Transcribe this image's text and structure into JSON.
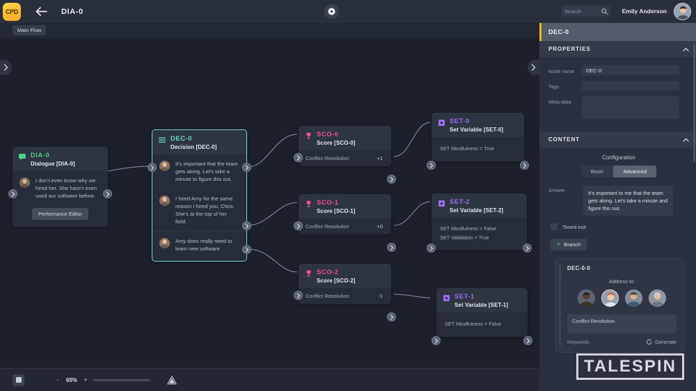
{
  "header": {
    "logo_text": "CPD",
    "back_icon": "back-arrow-icon",
    "title": "DIA-0",
    "play_icon": "play-icon",
    "search_placeholder": "Search",
    "search_value": "",
    "search_icon": "search-icon",
    "user_name": "Emily Anderson",
    "avatar": "user-avatar"
  },
  "canvas": {
    "flow_tab": "Main Flow",
    "nodes": [
      {
        "id": "DIA-0",
        "subtitle": "Dialogue [DIA-0]",
        "type": "dialogue",
        "accent": "#4fd08a",
        "lines": [
          "I don't even know why we hired her. She hasn't even used our software before."
        ],
        "button": "Performance Editor"
      },
      {
        "id": "DEC-0",
        "subtitle": "Decision [DEC-0]",
        "type": "decision",
        "accent": "#6fd9c9",
        "selected": true,
        "lines": [
          "It's important that the team gets along. Let's take a minute to figure this out.",
          "I hired Amy for the same reason I hired you, Chris. She's at the top of her field.",
          "Amy does really need to learn new software"
        ]
      },
      {
        "id": "SCO-0",
        "subtitle": "Score [SCO-0]",
        "type": "score",
        "accent": "#f0518f",
        "metric": "Conflict Resolution",
        "value": "+1"
      },
      {
        "id": "SCO-1",
        "subtitle": "Score [SCO-1]",
        "type": "score",
        "accent": "#f0518f",
        "metric": "Conflict Resolution",
        "value": "+0"
      },
      {
        "id": "SCO-2",
        "subtitle": "Score [SCO-2]",
        "type": "score",
        "accent": "#f0518f",
        "metric": "Conflict Resolution",
        "value": "-1"
      },
      {
        "id": "SET-0",
        "subtitle": "Set Variable [SET-0]",
        "type": "setvar",
        "accent": "#a06cf0",
        "assignments": [
          "SET Mindfulness = True"
        ]
      },
      {
        "id": "SET-2",
        "subtitle": "Set Variable [SET-2]",
        "type": "setvar",
        "accent": "#a06cf0",
        "assignments": [
          "SET Mindfulness = False",
          "SET Validation = True"
        ]
      },
      {
        "id": "SET-1",
        "subtitle": "Set Variable [SET-1]",
        "type": "setvar",
        "accent": "#a06cf0",
        "assignments": [
          "SET Mindfulness = False"
        ]
      }
    ]
  },
  "bottom_bar": {
    "fit_icon": "fit-to-screen-icon",
    "zoom_out": "-",
    "zoom_level": "65%",
    "zoom_in": "+",
    "warning_icon": "warning-icon"
  },
  "panel": {
    "title": "DEC-0",
    "accent_color": "#f5b81e",
    "properties": {
      "section_label": "PROPERTIES",
      "collapse_icon": "chevron-up-icon",
      "fields": [
        {
          "label": "Node name",
          "value": "DEC-0"
        },
        {
          "label": "Tags",
          "value": ""
        },
        {
          "label": "Meta-data",
          "value": ""
        }
      ]
    },
    "content": {
      "section_label": "CONTENT",
      "collapse_icon": "chevron-up-icon",
      "configuration_label": "Configuration",
      "tabs": [
        {
          "label": "Basic",
          "active": false
        },
        {
          "label": "Advanced",
          "active": true
        }
      ],
      "answer_label": "Answer",
      "answer_value": "It's important to me that the team gets along. Let's take a minute and figure this out.",
      "timed_exit_label": "Timed exit",
      "timed_exit_checked": false,
      "branch_button": "Branch",
      "branch_card": {
        "id": "DEC-0-0",
        "address_label": "Address to:",
        "avatars": [
          "avatar-1",
          "avatar-2",
          "avatar-3",
          "avatar-4"
        ],
        "selected_avatar_index": 1,
        "keyword_value": "Conflict Resolution",
        "keywords_label": "Keywords",
        "generate_label": "Generate",
        "generate_icon": "refresh-icon"
      }
    }
  },
  "watermark": {
    "text": "TALESPIN"
  }
}
